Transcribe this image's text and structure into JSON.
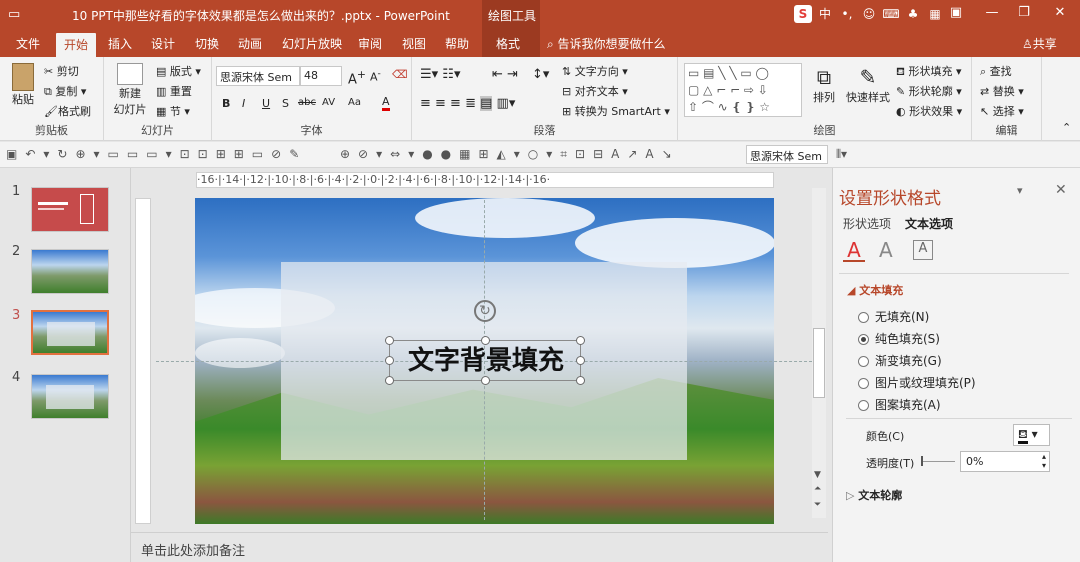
{
  "window": {
    "title": "10 PPT中那些好看的字体效果都是怎么做出来的？.pptx  -  PowerPoint",
    "tools_label": "绘图工具",
    "share": "共享"
  },
  "tabs": [
    "文件",
    "开始",
    "插入",
    "设计",
    "切换",
    "动画",
    "幻灯片放映",
    "审阅",
    "视图",
    "帮助",
    "格式"
  ],
  "active_tab": "开始",
  "tell_me": "告诉我你想要做什么",
  "ribbon": {
    "clipboard": {
      "paste": "粘贴",
      "cut": "剪切",
      "copy": "复制",
      "format_painter": "格式刷",
      "label": "剪贴板"
    },
    "slides": {
      "new_slide": "新建",
      "new_slide2": "幻灯片",
      "layout": "版式",
      "reset": "重置",
      "section": "节",
      "label": "幻灯片"
    },
    "font": {
      "name": "思源宋体 Sem",
      "size": "48",
      "label": "字体",
      "buttons": [
        "B",
        "I",
        "U",
        "S",
        "abc",
        "AV",
        "Aa",
        "A"
      ]
    },
    "paragraph": {
      "text_direction": "文字方向",
      "align_text": "对齐文本",
      "smartart": "转换为 SmartArt",
      "label": "段落"
    },
    "drawing": {
      "arrange": "排列",
      "quick_styles": "快速样式",
      "fill": "形状填充",
      "outline": "形状轮廓",
      "effects": "形状效果",
      "label": "绘图"
    },
    "editing": {
      "find": "查找",
      "replace": "替换",
      "select": "选择",
      "label": "编辑"
    }
  },
  "qat": {
    "font_name": "思源宋体 Sem"
  },
  "slides": [
    {
      "num": "1"
    },
    {
      "num": "2"
    },
    {
      "num": "3",
      "selected": true
    },
    {
      "num": "4"
    }
  ],
  "ruler": {
    "h": "·16·|·14·|·12·|·10·|·8·|·6·|·4·|·2·|·0·|·2·|·4·|·6·|·8·|·10·|·12·|·14·|·16·"
  },
  "slide": {
    "text": "文字背景填充"
  },
  "notes": "单击此处添加备注",
  "pane": {
    "title": "设置形状格式",
    "tab_shape": "形状选项",
    "tab_text": "文本选项",
    "section_fill": "文本填充",
    "options": [
      {
        "label": "无填充(N)",
        "on": false
      },
      {
        "label": "纯色填充(S)",
        "on": true
      },
      {
        "label": "渐变填充(G)",
        "on": false
      },
      {
        "label": "图片或纹理填充(P)",
        "on": false
      },
      {
        "label": "图案填充(A)",
        "on": false
      }
    ],
    "color_label": "颜色(C)",
    "transparency_label": "透明度(T)",
    "transparency_value": "0%",
    "section_outline": "文本轮廓"
  },
  "colors": {
    "accent": "#b7472a",
    "dark_accent": "#9c3a21"
  }
}
